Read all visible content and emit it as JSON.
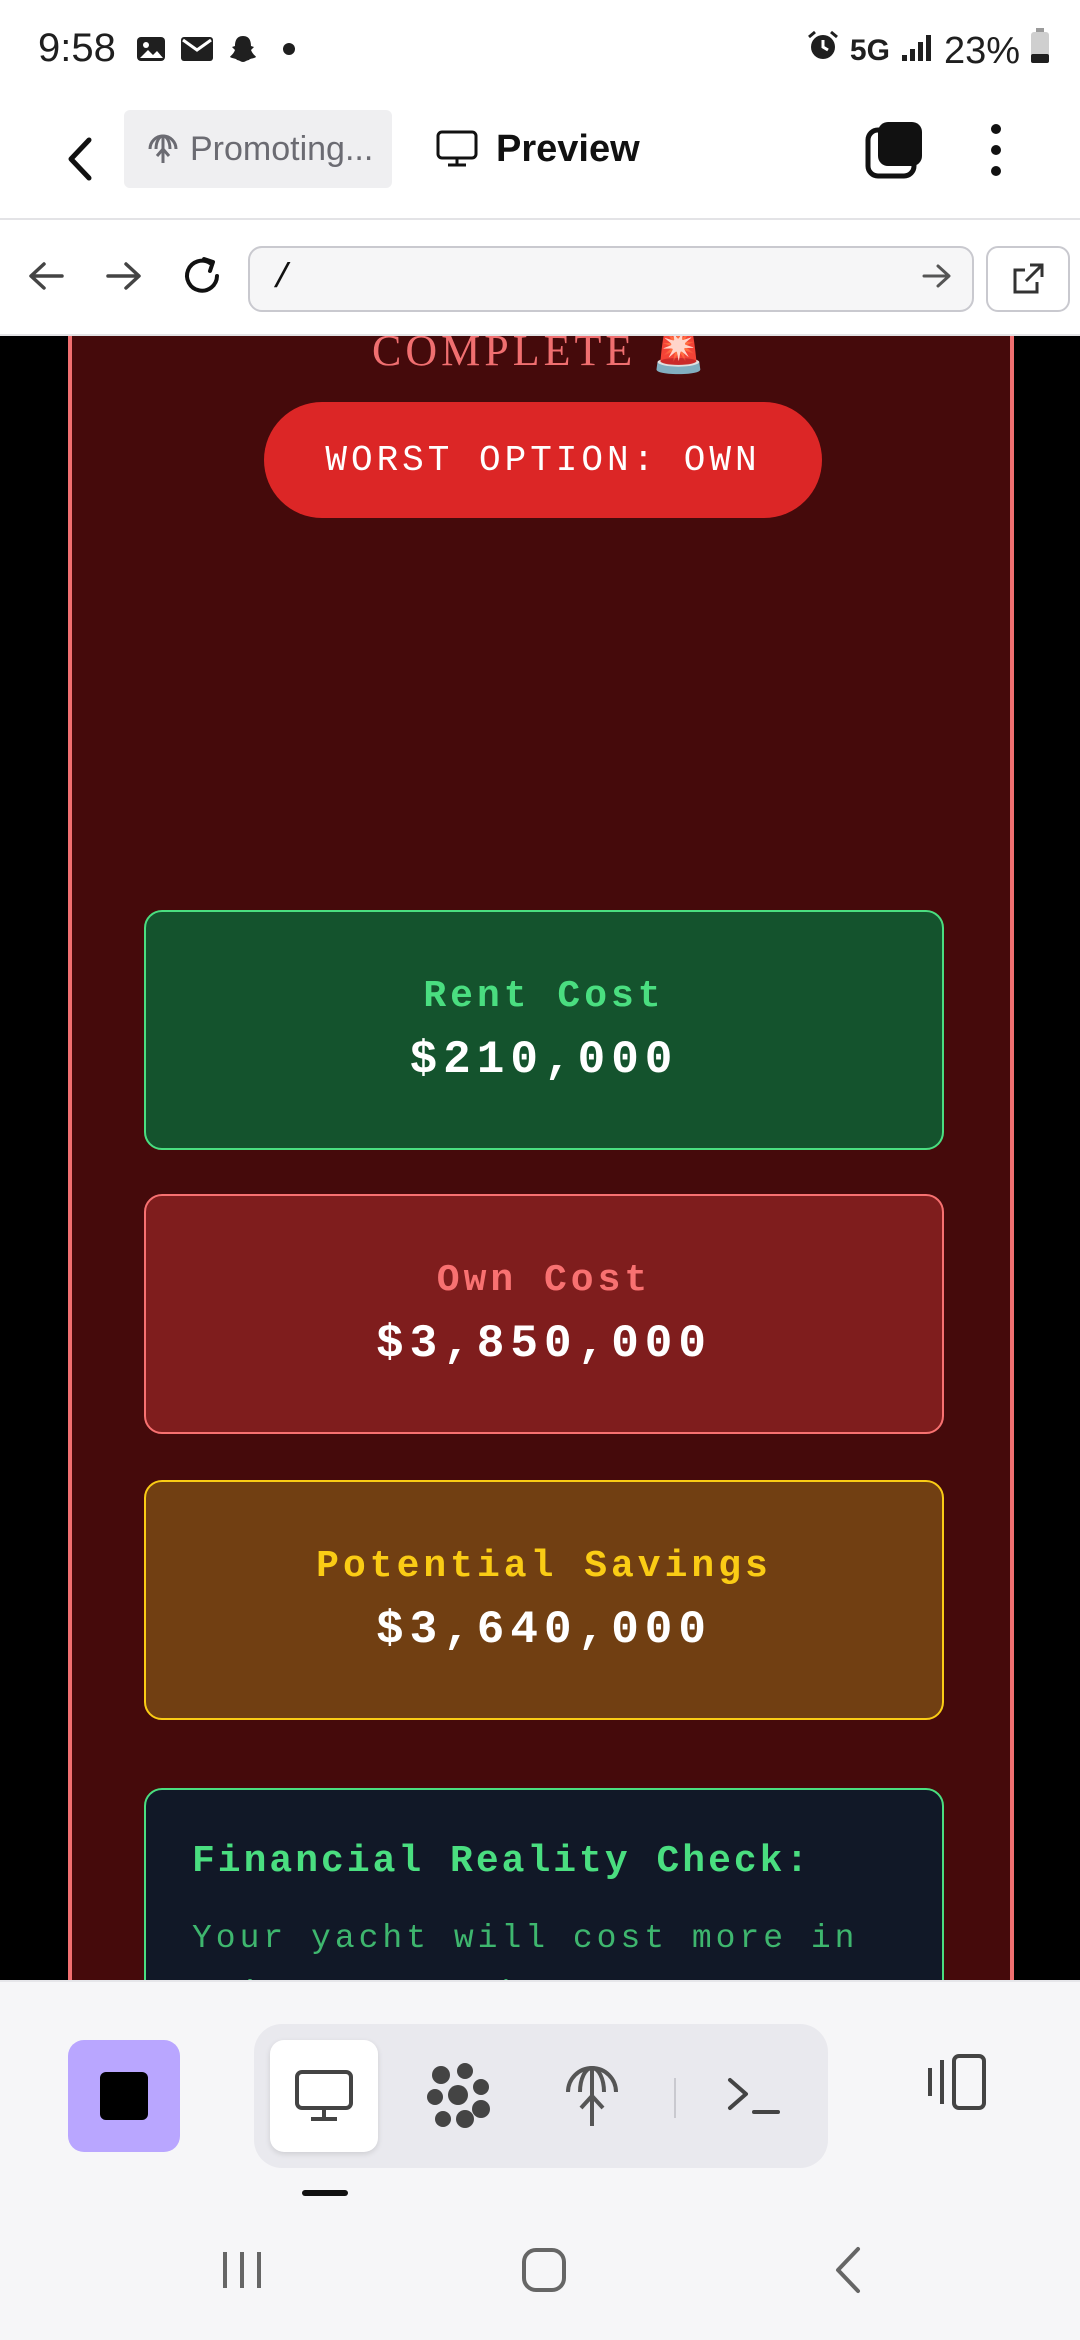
{
  "status_bar": {
    "time": "9:58",
    "network": "5G",
    "battery": "23%"
  },
  "app_bar": {
    "project_chip": "Promoting...",
    "preview_label": "Preview"
  },
  "url_bar": {
    "url": "/"
  },
  "page": {
    "complete_title": "COMPLETE",
    "complete_emoji": "🚨",
    "worst_option": "WORST OPTION: OWN",
    "cards": [
      {
        "label": "Rent Cost",
        "value": "$210,000"
      },
      {
        "label": "Own Cost",
        "value": "$3,850,000"
      },
      {
        "label": "Potential Savings",
        "value": "$3,640,000"
      }
    ],
    "reality_check": {
      "title": "Financial Reality Check:",
      "body": "Your yacht will cost more in maintenance than most people's houses are worth."
    }
  },
  "colors": {
    "panel_bg": "#450a0b",
    "panel_border": "#f06f70",
    "pill": "#dc2626",
    "rent_bg": "#14532d",
    "rent_text": "#4ade80",
    "own_bg": "#7f1d1d",
    "own_text": "#f87171",
    "save_bg": "#713f12",
    "save_text": "#facc15",
    "reality_bg": "#111827",
    "reality_text": "#4ade80",
    "stop_button": "#b9a6ff"
  },
  "icons": {
    "status": [
      "gallery-icon",
      "mail-icon",
      "snapchat-icon",
      "dot-icon",
      "alarm-icon",
      "signal-icon",
      "battery-icon"
    ],
    "toolbar": [
      "stop-icon",
      "monitor-icon",
      "integrations-icon",
      "deploy-icon",
      "terminal-icon",
      "layout-icon"
    ]
  }
}
